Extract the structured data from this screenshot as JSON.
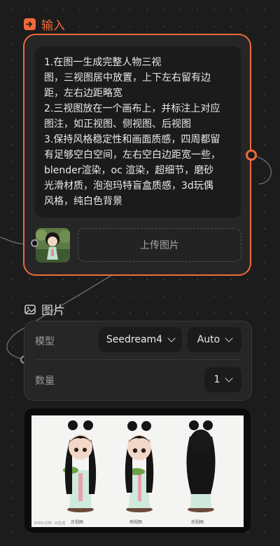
{
  "input_node": {
    "title": "输入",
    "prompt_lines": [
      "1.在图一生成完整人物三视",
      "图，三视图居中放置，上下左右留有边",
      "距，左右边距略宽",
      "2.三视图放在一个画布上，并标注上对应",
      "图注，如正视图、侧视图、后视图",
      "3.保持风格稳定性和画面质感，四周都留",
      "有足够空白空间，左右空白边距宽一些，",
      "blender渲染，oc 渲染，超细节，磨砂",
      "光滑材质，泡泡玛特盲盒质感，3d玩偶",
      "风格，纯白色背景"
    ],
    "upload_label": "上传图片",
    "thumbnail_icon": "reference-figure-thumbnail"
  },
  "image_node": {
    "title": "图片",
    "model_label": "模型",
    "model_value": "Seedream4",
    "size_value": "Auto",
    "count_label": "数量",
    "count_value": "1",
    "result": {
      "views": [
        "正视图",
        "侧视图",
        "后视图"
      ],
      "watermark": "2000L分辨 · AI生成"
    }
  },
  "colors": {
    "accent": "#ef6a3c",
    "background": "#1c1c1c",
    "card": "#262626"
  }
}
